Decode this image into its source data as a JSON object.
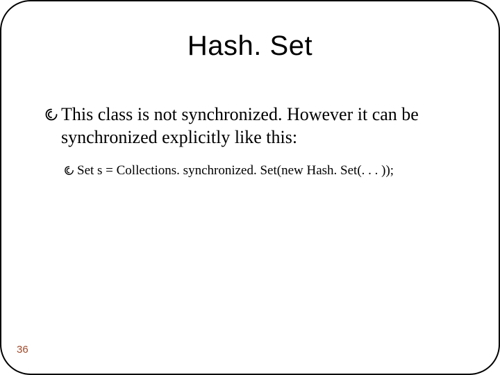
{
  "slide": {
    "title": "Hash. Set",
    "bullets": {
      "level1_text": "This class is not synchronized. However it can be synchronized explicitly like this:",
      "level2_text": "Set s = Collections. synchronized. Set(new Hash. Set(. . . ));"
    },
    "page_number": "36"
  }
}
